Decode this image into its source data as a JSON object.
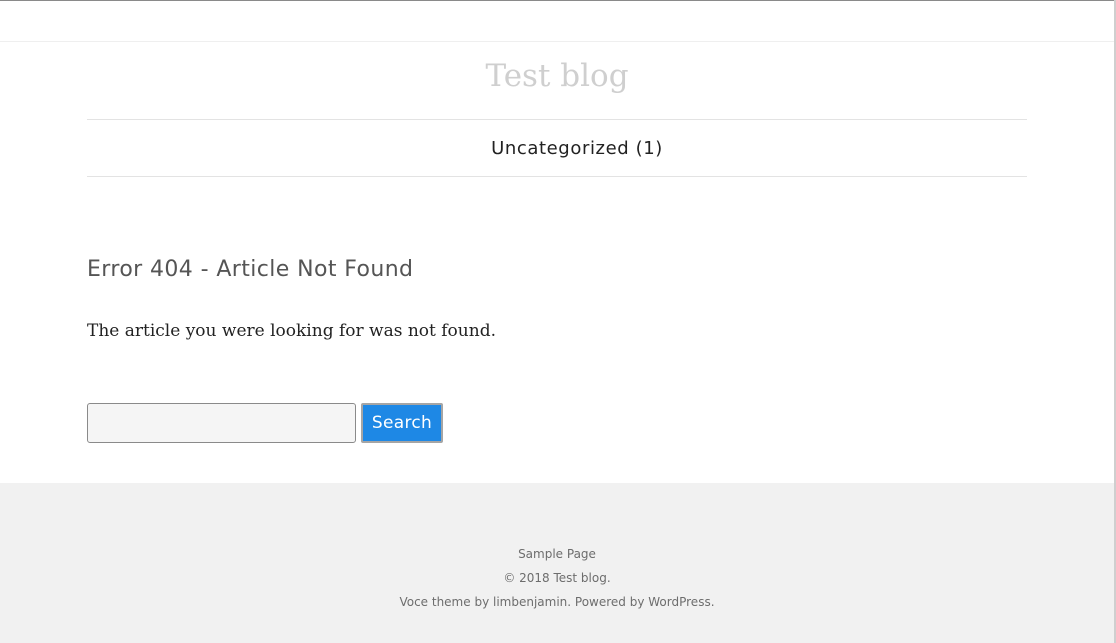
{
  "header": {
    "site_title": "Test blog"
  },
  "nav": {
    "category_label": "Uncategorized (1)"
  },
  "main": {
    "error_heading": "Error 404 - Article Not Found",
    "error_message": "The article you were looking for was not found.",
    "search": {
      "value": "",
      "button_label": "Search"
    }
  },
  "footer": {
    "page_link": "Sample Page",
    "copyright_prefix": "© 2018 ",
    "copyright_site": "Test blog",
    "copyright_suffix": ".",
    "theme_prefix": "Voce theme by ",
    "theme_author": "limbenjamin",
    "powered_prefix": ". Powered by ",
    "powered_link": "WordPress",
    "powered_suffix": "."
  },
  "colors": {
    "accent": "#1e88e5",
    "title_gray": "#cfcfcf",
    "footer_bg": "#f1f1f1"
  }
}
